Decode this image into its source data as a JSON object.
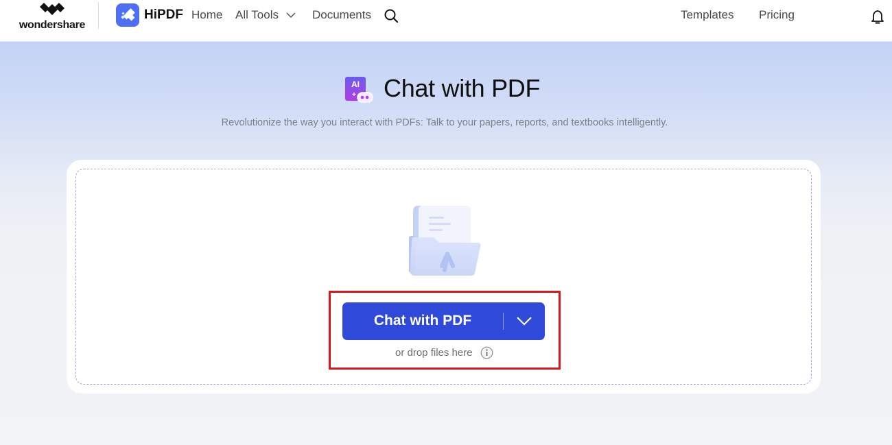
{
  "header": {
    "brand": "wondershare",
    "product": "HiPDF",
    "nav": {
      "home": "Home",
      "all_tools": "All Tools",
      "documents": "Documents",
      "templates": "Templates",
      "pricing": "Pricing"
    },
    "icons": {
      "search": "search-icon",
      "bell": "bell-icon",
      "chevron": "chevron-down-icon"
    }
  },
  "hero": {
    "icon_badge": "AI",
    "title": "Chat with PDF",
    "subtitle": "Revolutionize the way you interact with PDFs: Talk to your papers, reports, and textbooks intelligently."
  },
  "upload": {
    "button_label": "Chat with PDF",
    "drop_hint": "or drop files here",
    "info_glyph": "i"
  },
  "colors": {
    "brand_blue": "#4f6ef6",
    "button_blue": "#2f4ad9",
    "highlight_red": "#d9141a"
  }
}
